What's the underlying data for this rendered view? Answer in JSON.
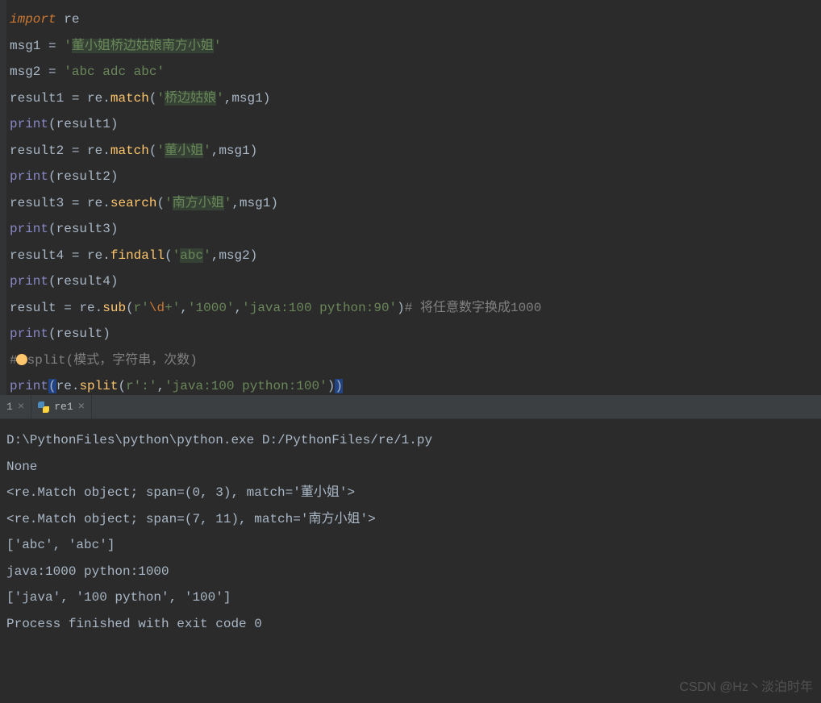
{
  "code": {
    "l1": {
      "kw": "import",
      "mod": "re"
    },
    "l2": {
      "lhs": "msg1",
      "op": "=",
      "q": "'",
      "s": "董小姐桥边姑娘南方小姐"
    },
    "l3": {
      "lhs": "msg2",
      "op": "=",
      "s": "'abc adc abc'"
    },
    "l4": {
      "lhs": "result1",
      "op": "=",
      "mod": "re",
      "dot": ".",
      "fn": "match",
      "lp": "(",
      "q": "'",
      "arg1": "桥边姑娘",
      "comma": ",",
      "arg2": "msg1",
      "rp": ")"
    },
    "l5": {
      "fn": "print",
      "lp": "(",
      "arg": "result1",
      "rp": ")"
    },
    "l6": {
      "lhs": "result2",
      "op": "=",
      "mod": "re",
      "dot": ".",
      "fn": "match",
      "lp": "(",
      "q": "'",
      "arg1": "董小姐",
      "comma": ",",
      "arg2": "msg1",
      "rp": ")"
    },
    "l7": {
      "fn": "print",
      "lp": "(",
      "arg": "result2",
      "rp": ")"
    },
    "l8": {
      "lhs": "result3",
      "op": "=",
      "mod": "re",
      "dot": ".",
      "fn": "search",
      "lp": "(",
      "q": "'",
      "arg1": "南方小姐",
      "comma": ",",
      "arg2": "msg1",
      "rp": ")"
    },
    "l9": {
      "fn": "print",
      "lp": "(",
      "arg": "result3",
      "rp": ")"
    },
    "l10": {
      "lhs": "result4",
      "op": "=",
      "mod": "re",
      "dot": ".",
      "fn": "findall",
      "lp": "(",
      "q": "'",
      "arg1": "abc",
      "comma": ",",
      "arg2": "msg2",
      "rp": ")"
    },
    "l11": {
      "fn": "print",
      "lp": "(",
      "arg": "result4",
      "rp": ")"
    },
    "l12": {
      "lhs": "result",
      "op": "=",
      "mod": "re",
      "dot": ".",
      "fn": "sub",
      "lp": "(",
      "r": "r'",
      "esc": "\\d",
      "plus": "+",
      "q2": "'",
      "c1": ",",
      "a2": "'1000'",
      "c2": ",",
      "a3": "'java:100 python:90'",
      "rp": ")",
      "cmt": "# 将任意数字换成1000"
    },
    "l13": {
      "fn": "print",
      "lp": "(",
      "arg": "result",
      "rp": ")"
    },
    "l14": {
      "hash": "#",
      "txt": "split(模式，字符串，次数)"
    },
    "l15": {
      "fn": "print",
      "lp": "(",
      "mod": "re",
      "dot": ".",
      "fn2": "split",
      "lp2": "(",
      "a1": "r':'",
      "c1": ",",
      "a2": "'java:100 python:100'",
      "rp2": ")",
      "rp": ")"
    }
  },
  "tabs": {
    "t1": {
      "label": "1",
      "close": "×"
    },
    "t2": {
      "label": "re1",
      "close": "×"
    }
  },
  "console": {
    "l1": "D:\\PythonFiles\\python\\python.exe D:/PythonFiles/re/1.py",
    "l2": "None",
    "l3": "<re.Match object; span=(0, 3), match='董小姐'>",
    "l4": "<re.Match object; span=(7, 11), match='南方小姐'>",
    "l5": "['abc', 'abc']",
    "l6": "java:1000 python:1000",
    "l7": "['java', '100 python', '100']",
    "l8": "",
    "l9": "Process finished with exit code 0"
  },
  "watermark": "CSDN @Hz丶淡泊时年"
}
